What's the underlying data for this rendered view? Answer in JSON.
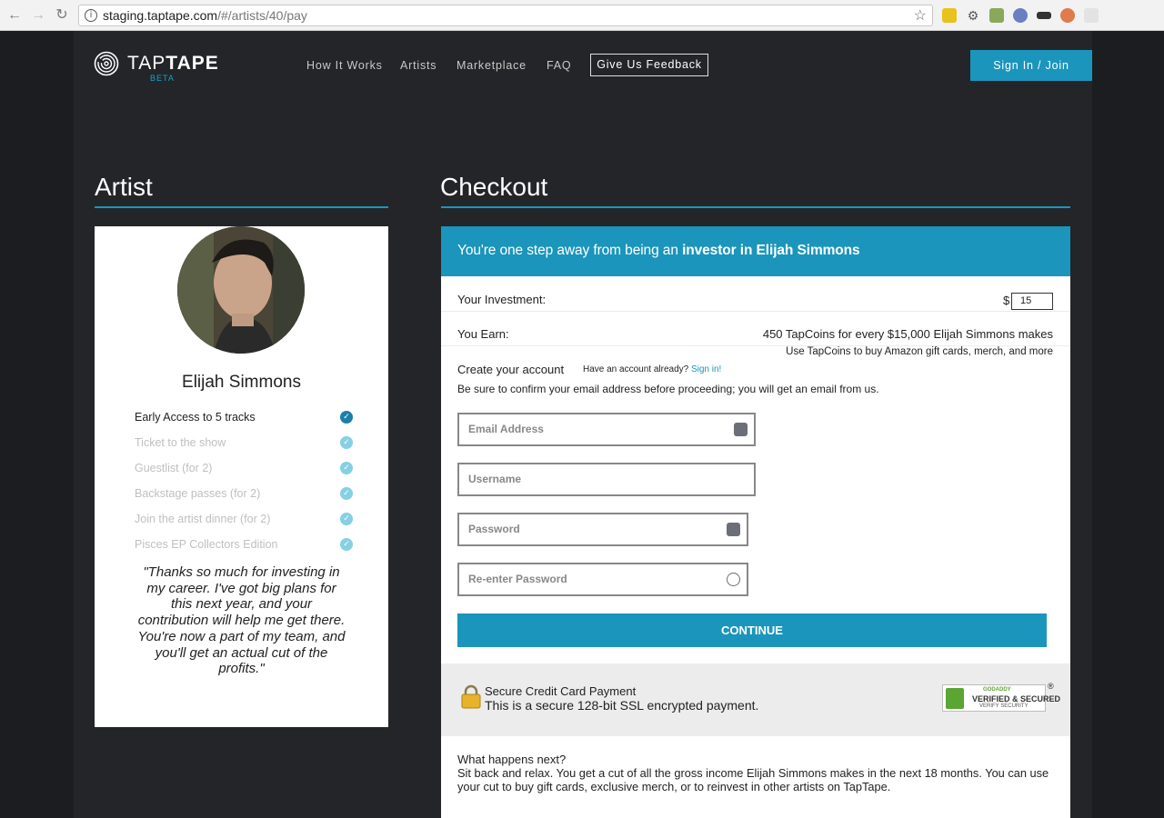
{
  "browser": {
    "url_host": "staging.taptape.com",
    "url_path": "/#/artists/40/pay"
  },
  "brand": {
    "name": "TAPTAPE",
    "name_a": "TAP",
    "name_b": "TAPE",
    "badge": "BETA",
    "accent_color": "#1b95bb"
  },
  "nav": {
    "items": [
      "How It Works",
      "Artists",
      "Marketplace",
      "FAQ"
    ],
    "feedback_label": "Give Us Feedback",
    "signin_label": "Sign In / Join"
  },
  "artist_section": {
    "title": "Artist",
    "name": "Elijah Simmons",
    "perks": [
      {
        "label": "Early Access to 5 tracks",
        "active": true
      },
      {
        "label": "Ticket to the show",
        "active": false
      },
      {
        "label": "Guestlist (for 2)",
        "active": false
      },
      {
        "label": "Backstage passes (for 2)",
        "active": false
      },
      {
        "label": "Join the artist dinner (for 2)",
        "active": false
      },
      {
        "label": "Pisces EP Collectors Edition",
        "active": false
      }
    ],
    "quote": "\"Thanks so much for investing in my career. I've got big plans for this next year, and your contribution will help me get there. You're now a part of my team, and you'll get an actual cut of the profits.\""
  },
  "checkout": {
    "title": "Checkout",
    "banner_prefix": "You're one step away from being an ",
    "banner_bold": "investor in Elijah Simmons",
    "investment_label": "Your Investment:",
    "currency": "$",
    "investment_value": "15",
    "earn_label": "You Earn:",
    "earn_value": "450 TapCoins for every $15,000 Elijah Simmons makes",
    "earn_note": "Use TapCoins to buy Amazon gift cards, merch, and more",
    "create_title": "Create your account",
    "have_account": "Have an account already?",
    "signin_link": "Sign in!",
    "confirm_note": "Be sure to confirm your email address before proceeding; you will get an email from us.",
    "fields": {
      "email": "Email Address",
      "username": "Username",
      "password": "Password",
      "repassword": "Re-enter Password"
    },
    "continue_label": "CONTINUE",
    "secure_title": "Secure Credit Card Payment",
    "secure_sub": "This is a secure 128-bit SSL encrypted payment.",
    "badge_top": "GODADDY",
    "badge_mid": "VERIFIED & SECURED",
    "badge_bot": "VERIFY SECURITY",
    "reg_mark": "®",
    "next_title": "What happens next?",
    "next_body": "Sit back and relax. You get a cut of all the gross income Elijah Simmons makes in the next 18 months. You can use your cut to buy gift cards, exclusive merch, or to reinvest in other artists on TapTape."
  }
}
